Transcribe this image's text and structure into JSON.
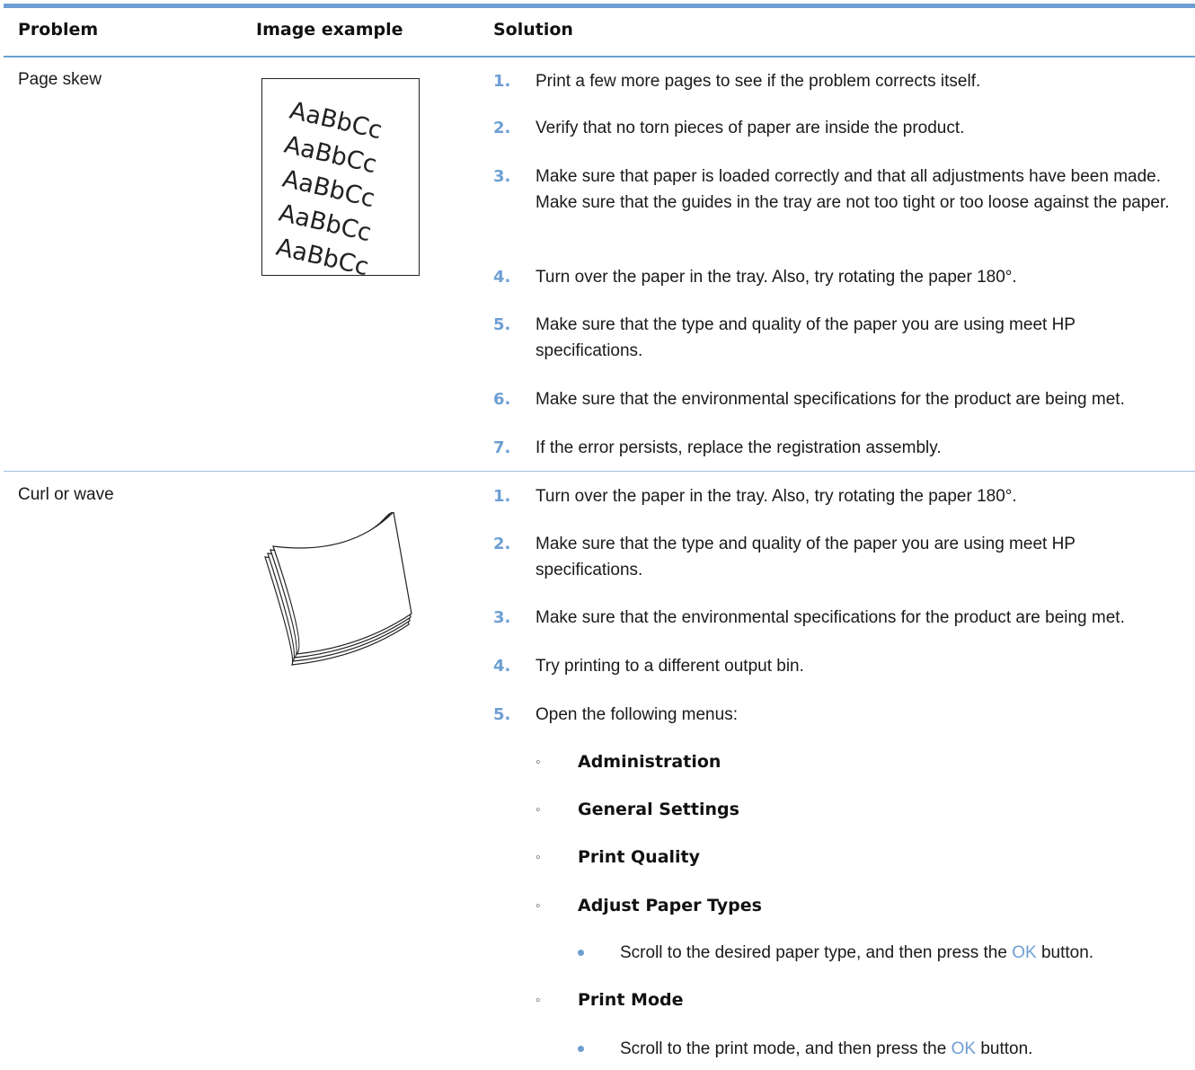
{
  "header": {
    "col_problem": "Problem",
    "col_image": "Image example",
    "col_solution": "Solution"
  },
  "rows": [
    {
      "problem": "Page skew",
      "image_text": [
        "AaBbCc",
        "AaBbCc",
        "AaBbCc",
        "AaBbCc",
        "AaBbCc"
      ],
      "steps": [
        {
          "num": "1.",
          "text": "Print a few more pages to see if the problem corrects itself."
        },
        {
          "num": "2.",
          "text": "Verify that no torn pieces of paper are inside the product."
        },
        {
          "num": "3.",
          "text": "Make sure that paper is loaded correctly and that all adjustments have been made. Make sure that the guides in the tray are not too tight or too loose against the paper."
        },
        {
          "num": "4.",
          "text": "Turn over the paper in the tray. Also, try rotating the paper 180°."
        },
        {
          "num": "5.",
          "text": "Make sure that the type and quality of the paper you are using meet HP specifications."
        },
        {
          "num": "6.",
          "text": "Make sure that the environmental specifications for the product are being met."
        },
        {
          "num": "7.",
          "text": "If the error persists, replace the registration assembly."
        }
      ]
    },
    {
      "problem": "Curl or wave",
      "steps": [
        {
          "num": "1.",
          "text": "Turn over the paper in the tray. Also, try rotating the paper 180°."
        },
        {
          "num": "2.",
          "text": "Make sure that the type and quality of the paper you are using meet HP specifications."
        },
        {
          "num": "3.",
          "text": "Make sure that the environmental specifications for the product are being met."
        },
        {
          "num": "4.",
          "text": "Try printing to a different output bin."
        },
        {
          "num": "5.",
          "text": "Open the following menus:"
        }
      ],
      "menus": [
        {
          "label": "Administration"
        },
        {
          "label": "General Settings"
        },
        {
          "label": "Print Quality"
        },
        {
          "label": "Adjust Paper Types"
        },
        {
          "label": "Print Mode"
        }
      ],
      "bullets": [
        {
          "before": "Scroll to the desired paper type, and then press the ",
          "ok": "OK",
          "after": " button."
        },
        {
          "before": "Scroll to the print mode, and then press the ",
          "ok": "OK",
          "after": " button."
        }
      ]
    }
  ],
  "colors": {
    "accent": "#6d9fd3",
    "text": "#1a1a1a"
  }
}
